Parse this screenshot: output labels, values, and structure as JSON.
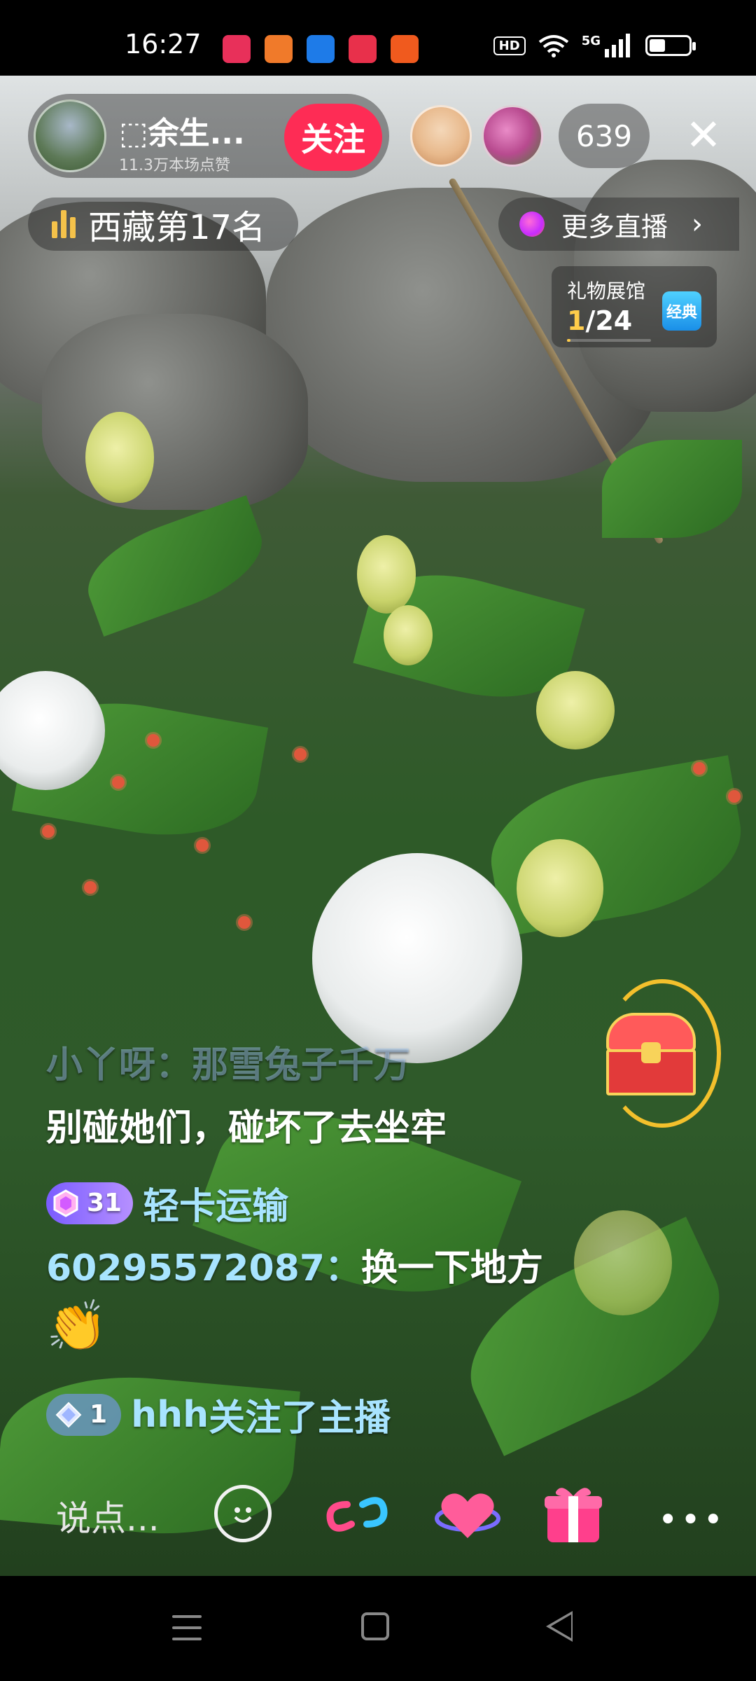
{
  "status_bar": {
    "time": "16:27",
    "network": "5G",
    "hd": "HD",
    "battery_level": 0.4,
    "app_icons": [
      {
        "name": "app-red-icon",
        "color": "#e8305a"
      },
      {
        "name": "app-orange-icon",
        "color": "#f07a2a"
      },
      {
        "name": "app-blue-icon",
        "color": "#1e7be8"
      },
      {
        "name": "app-video-icon",
        "color": "#e8304b"
      },
      {
        "name": "app-orange2-icon",
        "color": "#f05a1e"
      }
    ]
  },
  "anchor": {
    "name": "⬚余生...",
    "likes": "11.3万本场点赞",
    "follow_label": "关注"
  },
  "viewer_count": "639",
  "rank": "西藏第17名",
  "more_live": "更多直播",
  "gift_hall": {
    "title": "礼物展馆",
    "current": "1",
    "total": "/24",
    "badge": "经典",
    "progress": 0.04
  },
  "chat": {
    "faded": "小丫呀：那雪兔子千万",
    "message1": "别碰她们，碰坏了去坐牢",
    "message2": {
      "badge_level": "31",
      "user": "轻卡运输"
    },
    "message3": {
      "user": "60295572087：",
      "text": "换一下地方"
    },
    "message4": "👏",
    "message5": {
      "badge_level": "1",
      "user": "hhh",
      "text": " 关注了主播"
    }
  },
  "toolbar": {
    "input_placeholder": "说点...",
    "more_label": "•••"
  },
  "colors": {
    "follow": "#fe2c55",
    "accent_gold": "#ffcc4a",
    "username": "#a8e4ff"
  }
}
